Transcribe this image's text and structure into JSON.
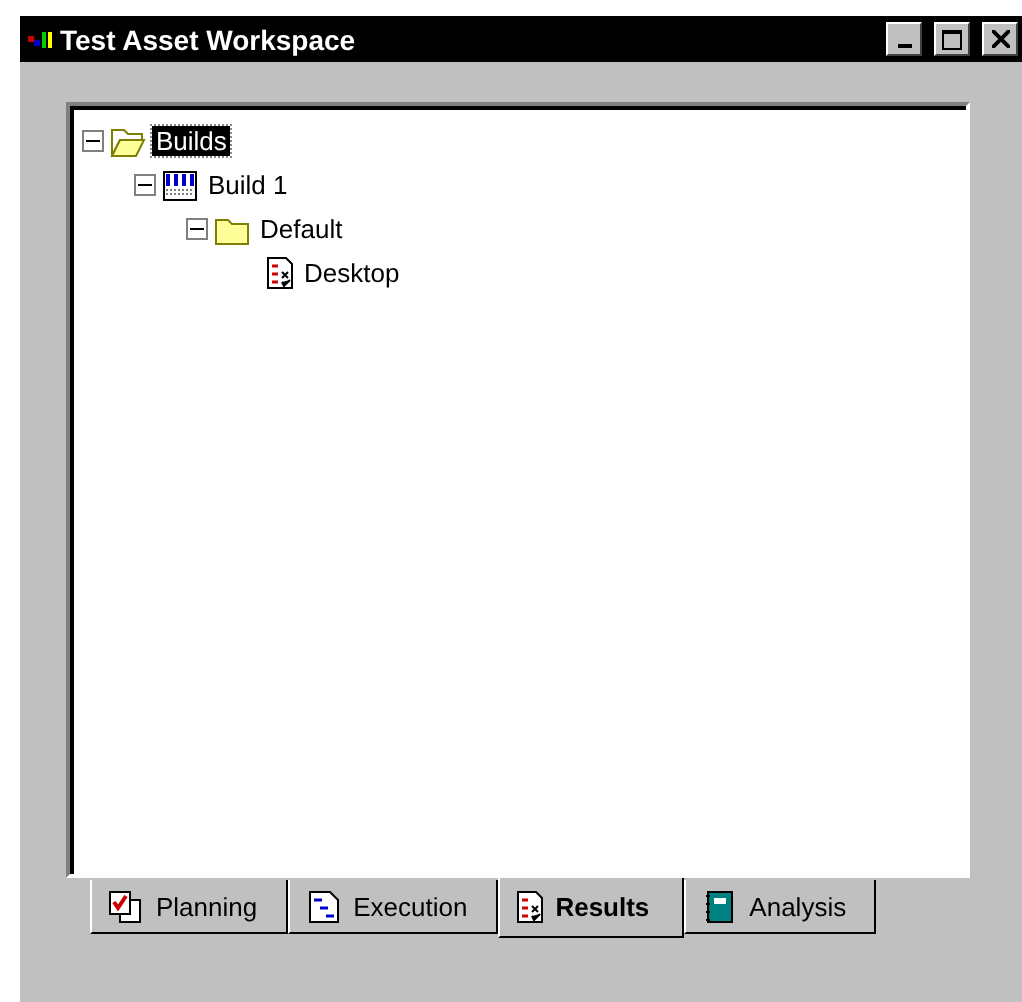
{
  "window": {
    "title": "Test Asset Workspace"
  },
  "tree": [
    {
      "label": "Builds",
      "kind": "folder-open",
      "expanded": true,
      "selected": true,
      "children": [
        {
          "label": "Build 1",
          "kind": "build",
          "expanded": true,
          "selected": false,
          "children": [
            {
              "label": "Default",
              "kind": "folder",
              "expanded": true,
              "selected": false,
              "children": [
                {
                  "label": "Desktop",
                  "kind": "results",
                  "selected": false
                }
              ]
            }
          ]
        }
      ]
    }
  ],
  "tabs": [
    {
      "label": "Planning",
      "kind": "planning",
      "selected": false
    },
    {
      "label": "Execution",
      "kind": "execution",
      "selected": false
    },
    {
      "label": "Results",
      "kind": "results",
      "selected": true
    },
    {
      "label": "Analysis",
      "kind": "analysis",
      "selected": false
    }
  ]
}
